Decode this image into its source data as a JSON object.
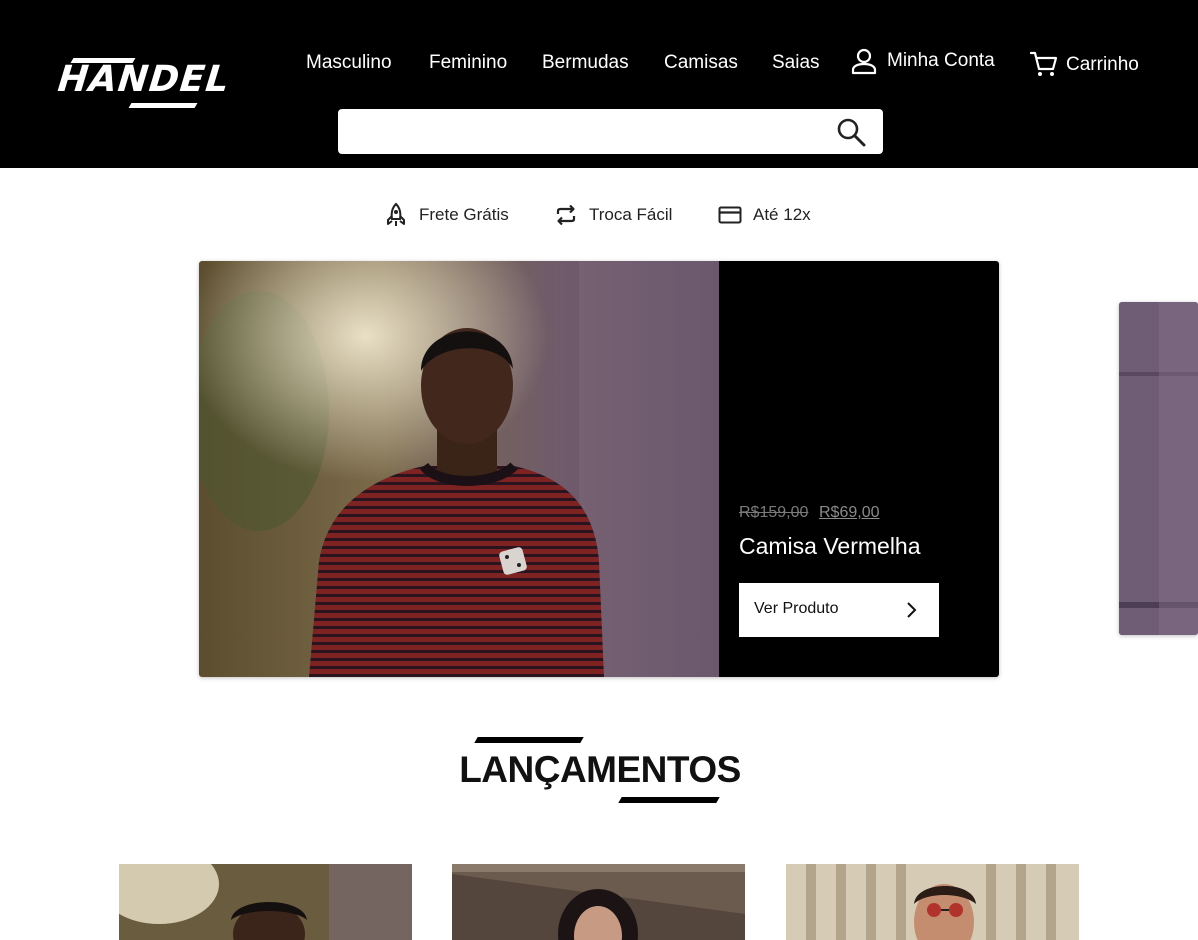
{
  "brand": {
    "logo_text": "HANDEL"
  },
  "nav": {
    "items": [
      {
        "label": "Masculino"
      },
      {
        "label": "Feminino"
      },
      {
        "label": "Bermudas"
      },
      {
        "label": "Camisas"
      },
      {
        "label": "Saias"
      }
    ],
    "account_label": "Minha Conta",
    "cart_label": "Carrinho"
  },
  "search": {
    "placeholder": "",
    "value": ""
  },
  "benefits": [
    {
      "label": "Frete Grátis",
      "icon": "rocket-icon"
    },
    {
      "label": "Troca Fácil",
      "icon": "exchange-icon"
    },
    {
      "label": "Até 12x",
      "icon": "credit-card-icon"
    }
  ],
  "hero": {
    "price_old": "R$159,00",
    "price_new": "R$69,00",
    "product_name": "Camisa Vermelha",
    "cta_label": "Ver Produto"
  },
  "section": {
    "title": "LANÇAMENTOS"
  },
  "colors": {
    "header_bg": "#000000",
    "page_bg": "#ffffff",
    "hero_panel_bg": "#000000"
  }
}
